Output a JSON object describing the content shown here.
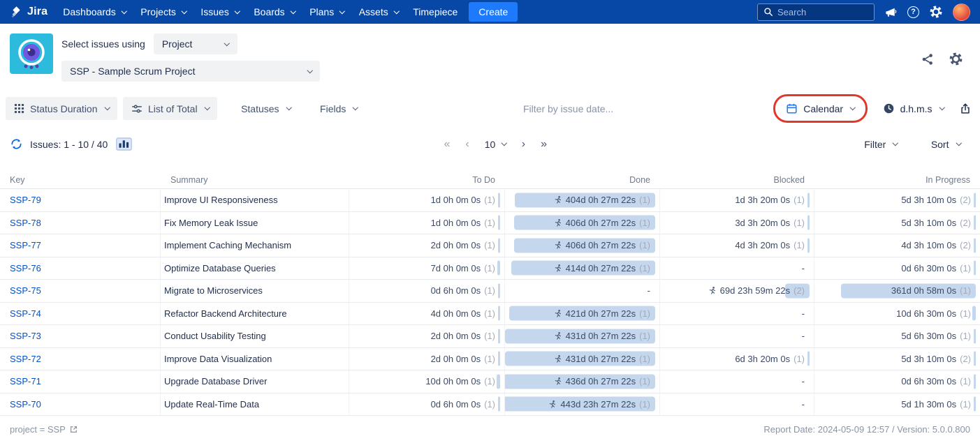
{
  "colors": {
    "navbar": "#0747A6",
    "accent": "#1D7AFC",
    "link": "#0052CC",
    "bar_fill": "#C4D7ED",
    "annotation_red": "#E0392C"
  },
  "navbar": {
    "brand": "Jira",
    "items": [
      "Dashboards",
      "Projects",
      "Issues",
      "Boards",
      "Plans",
      "Assets"
    ],
    "static_item": "Timepiece",
    "create_label": "Create",
    "search_placeholder": "Search"
  },
  "header": {
    "select_label": "Select issues using",
    "mode_value": "Project",
    "project_value": "SSP - Sample Scrum Project"
  },
  "toolbar": {
    "report_type_label": "Status Duration",
    "list_type_label": "List of Total",
    "statuses_label": "Statuses",
    "fields_label": "Fields",
    "date_filter_placeholder": "Filter by issue date...",
    "calendar_label": "Calendar",
    "time_format_label": "d.h.m.s"
  },
  "pager": {
    "issues_label": "Issues: 1 - 10 / 40",
    "first": "«",
    "prev": "‹",
    "next": "›",
    "last": "»",
    "page_size": "10",
    "filter_label": "Filter",
    "sort_label": "Sort"
  },
  "table": {
    "columns": [
      "Key",
      "Summary",
      "To Do",
      "Done",
      "Blocked",
      "In Progress"
    ],
    "rows": [
      {
        "key": "SSP-79",
        "summary": "Improve UI Responsiveness",
        "to_do": {
          "text": "1d 0h 0m 0s",
          "count": "(1)",
          "pct": 0.2,
          "icon": false
        },
        "done": {
          "text": "404d 0h 27m 22s",
          "count": "(1)",
          "pct": 91.0,
          "icon": true
        },
        "blocked": {
          "text": "1d 3h 20m 0s",
          "count": "(1)",
          "pct": 0.3,
          "icon": false
        },
        "in_progress": {
          "text": "5d 3h 10m 0s",
          "count": "(2)",
          "pct": 1.2,
          "icon": false
        }
      },
      {
        "key": "SSP-78",
        "summary": "Fix Memory Leak Issue",
        "to_do": {
          "text": "1d 0h 0m 0s",
          "count": "(1)",
          "pct": 0.2,
          "icon": false
        },
        "done": {
          "text": "406d 0h 27m 22s",
          "count": "(1)",
          "pct": 91.4,
          "icon": true
        },
        "blocked": {
          "text": "3d 3h 20m 0s",
          "count": "(1)",
          "pct": 0.7,
          "icon": false
        },
        "in_progress": {
          "text": "5d 3h 10m 0s",
          "count": "(2)",
          "pct": 1.2,
          "icon": false
        }
      },
      {
        "key": "SSP-77",
        "summary": "Implement Caching Mechanism",
        "to_do": {
          "text": "2d 0h 0m 0s",
          "count": "(1)",
          "pct": 0.5,
          "icon": false
        },
        "done": {
          "text": "406d 0h 27m 22s",
          "count": "(1)",
          "pct": 91.4,
          "icon": true
        },
        "blocked": {
          "text": "4d 3h 20m 0s",
          "count": "(1)",
          "pct": 0.9,
          "icon": false
        },
        "in_progress": {
          "text": "4d 3h 10m 0s",
          "count": "(2)",
          "pct": 0.9,
          "icon": false
        }
      },
      {
        "key": "SSP-76",
        "summary": "Optimize Database Queries",
        "to_do": {
          "text": "7d 0h 0m 0s",
          "count": "(1)",
          "pct": 1.6,
          "icon": false
        },
        "done": {
          "text": "414d 0h 27m 22s",
          "count": "(1)",
          "pct": 93.2,
          "icon": true
        },
        "blocked": {
          "text": "-",
          "count": "",
          "pct": 0,
          "icon": false
        },
        "in_progress": {
          "text": "0d 6h 30m 0s",
          "count": "(1)",
          "pct": 0.1,
          "icon": false
        }
      },
      {
        "key": "SSP-75",
        "summary": "Migrate to Microservices",
        "to_do": {
          "text": "0d 6h 0m 0s",
          "count": "(1)",
          "pct": 0.1,
          "icon": false
        },
        "done": {
          "text": "-",
          "count": "",
          "pct": 0,
          "icon": false
        },
        "blocked": {
          "text": "69d 23h 59m 22s",
          "count": "(2)",
          "pct": 15.8,
          "icon": true
        },
        "in_progress": {
          "text": "361d 0h 58m 0s",
          "count": "(1)",
          "pct": 81.3,
          "icon": false
        }
      },
      {
        "key": "SSP-74",
        "summary": "Refactor Backend Architecture",
        "to_do": {
          "text": "4d 0h 0m 0s",
          "count": "(1)",
          "pct": 0.9,
          "icon": false
        },
        "done": {
          "text": "421d 0h 27m 22s",
          "count": "(1)",
          "pct": 94.8,
          "icon": true
        },
        "blocked": {
          "text": "-",
          "count": "",
          "pct": 0,
          "icon": false
        },
        "in_progress": {
          "text": "10d 6h 30m 0s",
          "count": "(1)",
          "pct": 2.3,
          "icon": false
        }
      },
      {
        "key": "SSP-73",
        "summary": "Conduct Usability Testing",
        "to_do": {
          "text": "2d 0h 0m 0s",
          "count": "(1)",
          "pct": 0.5,
          "icon": false
        },
        "done": {
          "text": "431d 0h 27m 22s",
          "count": "(1)",
          "pct": 97.1,
          "icon": true
        },
        "blocked": {
          "text": "-",
          "count": "",
          "pct": 0,
          "icon": false
        },
        "in_progress": {
          "text": "5d 6h 30m 0s",
          "count": "(1)",
          "pct": 1.2,
          "icon": false
        }
      },
      {
        "key": "SSP-72",
        "summary": "Improve Data Visualization",
        "to_do": {
          "text": "2d 0h 0m 0s",
          "count": "(1)",
          "pct": 0.5,
          "icon": false
        },
        "done": {
          "text": "431d 0h 27m 22s",
          "count": "(1)",
          "pct": 97.1,
          "icon": true
        },
        "blocked": {
          "text": "6d 3h 20m 0s",
          "count": "(1)",
          "pct": 1.4,
          "icon": false
        },
        "in_progress": {
          "text": "5d 3h 10m 0s",
          "count": "(2)",
          "pct": 1.2,
          "icon": false
        }
      },
      {
        "key": "SSP-71",
        "summary": "Upgrade Database Driver",
        "to_do": {
          "text": "10d 0h 0m 0s",
          "count": "(1)",
          "pct": 2.3,
          "icon": false
        },
        "done": {
          "text": "436d 0h 27m 22s",
          "count": "(1)",
          "pct": 98.2,
          "icon": true
        },
        "blocked": {
          "text": "-",
          "count": "",
          "pct": 0,
          "icon": false
        },
        "in_progress": {
          "text": "0d 6h 30m 0s",
          "count": "(1)",
          "pct": 0.1,
          "icon": false
        }
      },
      {
        "key": "SSP-70",
        "summary": "Update Real-Time Data",
        "to_do": {
          "text": "0d 6h 0m 0s",
          "count": "(1)",
          "pct": 0.1,
          "icon": false
        },
        "done": {
          "text": "443d 23h 27m 22s",
          "count": "(1)",
          "pct": 100,
          "icon": true
        },
        "blocked": {
          "text": "-",
          "count": "",
          "pct": 0,
          "icon": false
        },
        "in_progress": {
          "text": "5d 1h 30m 0s",
          "count": "(1)",
          "pct": 1.1,
          "icon": false
        }
      }
    ]
  },
  "footer": {
    "query": "project = SSP",
    "report_info": "Report Date: 2024-05-09 12:57 / Version: 5.0.0.800"
  }
}
